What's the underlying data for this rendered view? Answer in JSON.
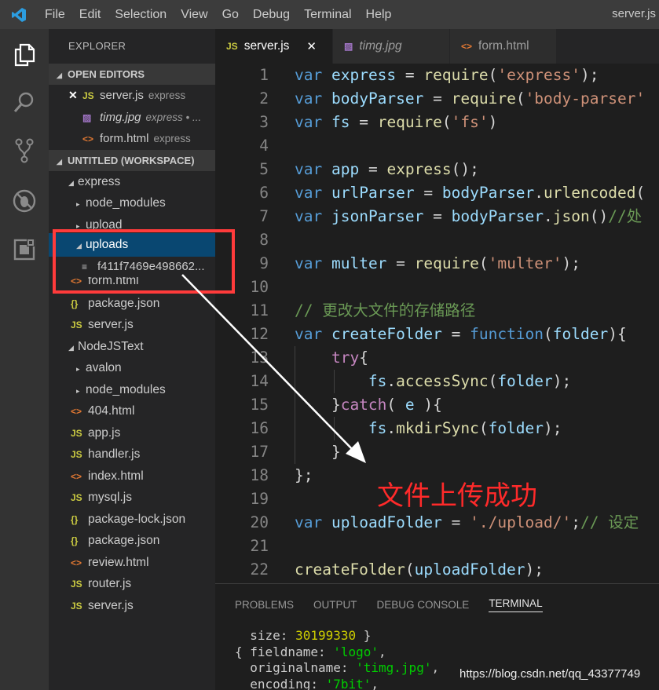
{
  "menubar": {
    "items": [
      "File",
      "Edit",
      "Selection",
      "View",
      "Go",
      "Debug",
      "Terminal",
      "Help"
    ],
    "window_title": "server.js"
  },
  "sidebar": {
    "title": "EXPLORER",
    "open_editors_header": "OPEN EDITORS",
    "open_editors": [
      {
        "name": "server.js",
        "desc": "express"
      },
      {
        "name": "timg.jpg",
        "desc": "express • ..."
      },
      {
        "name": "form.html",
        "desc": "express"
      }
    ],
    "workspace_header": "UNTITLED (WORKSPACE)",
    "tree": [
      {
        "name": "express",
        "icon": "folder-open"
      },
      {
        "name": "node_modules",
        "icon": "folder-closed"
      },
      {
        "name": "upload",
        "icon": "folder-closed"
      },
      {
        "name": "uploads",
        "icon": "folder-open"
      },
      {
        "name": "f411f7469e498662...",
        "icon": "file-icon"
      },
      {
        "name": "form.html",
        "icon": "html-icon"
      },
      {
        "name": "package.json",
        "icon": "json-icon"
      },
      {
        "name": "server.js",
        "icon": "js-icon"
      },
      {
        "name": "NodeJSText",
        "icon": "folder-open"
      },
      {
        "name": "avalon",
        "icon": "folder-closed"
      },
      {
        "name": "node_modules",
        "icon": "folder-closed"
      },
      {
        "name": "404.html",
        "icon": "html-icon"
      },
      {
        "name": "app.js",
        "icon": "js-icon"
      },
      {
        "name": "handler.js",
        "icon": "js-icon"
      },
      {
        "name": "index.html",
        "icon": "html-icon"
      },
      {
        "name": "mysql.js",
        "icon": "js-icon"
      },
      {
        "name": "package-lock.json",
        "icon": "json-icon"
      },
      {
        "name": "package.json",
        "icon": "json-icon"
      },
      {
        "name": "review.html",
        "icon": "html-icon"
      },
      {
        "name": "router.js",
        "icon": "js-icon"
      },
      {
        "name": "server.js",
        "icon": "js-icon"
      }
    ]
  },
  "tabs": [
    {
      "label": "server.js",
      "icon": "js-icon",
      "active": true
    },
    {
      "label": "timg.jpg",
      "icon": "image-icon",
      "active": false
    },
    {
      "label": "form.html",
      "icon": "html-icon",
      "active": false
    }
  ],
  "editor": {
    "line_numbers": [
      "1",
      "2",
      "3",
      "4",
      "5",
      "6",
      "7",
      "8",
      "9",
      "10",
      "11",
      "12",
      "13",
      "14",
      "15",
      "16",
      "17",
      "18",
      "19",
      "20",
      "21",
      "22"
    ]
  },
  "panel": {
    "tabs": [
      "PROBLEMS",
      "OUTPUT",
      "DEBUG CONSOLE",
      "TERMINAL"
    ],
    "active_tab": "TERMINAL"
  },
  "annotation": {
    "text": "文件上传成功",
    "color": "#ff2a2a"
  },
  "watermark": "https://blog.csdn.net/qq_43377749",
  "colors": {
    "accent": "#007acc",
    "selection": "#094771",
    "highlight_box": "#ff3b3b"
  }
}
